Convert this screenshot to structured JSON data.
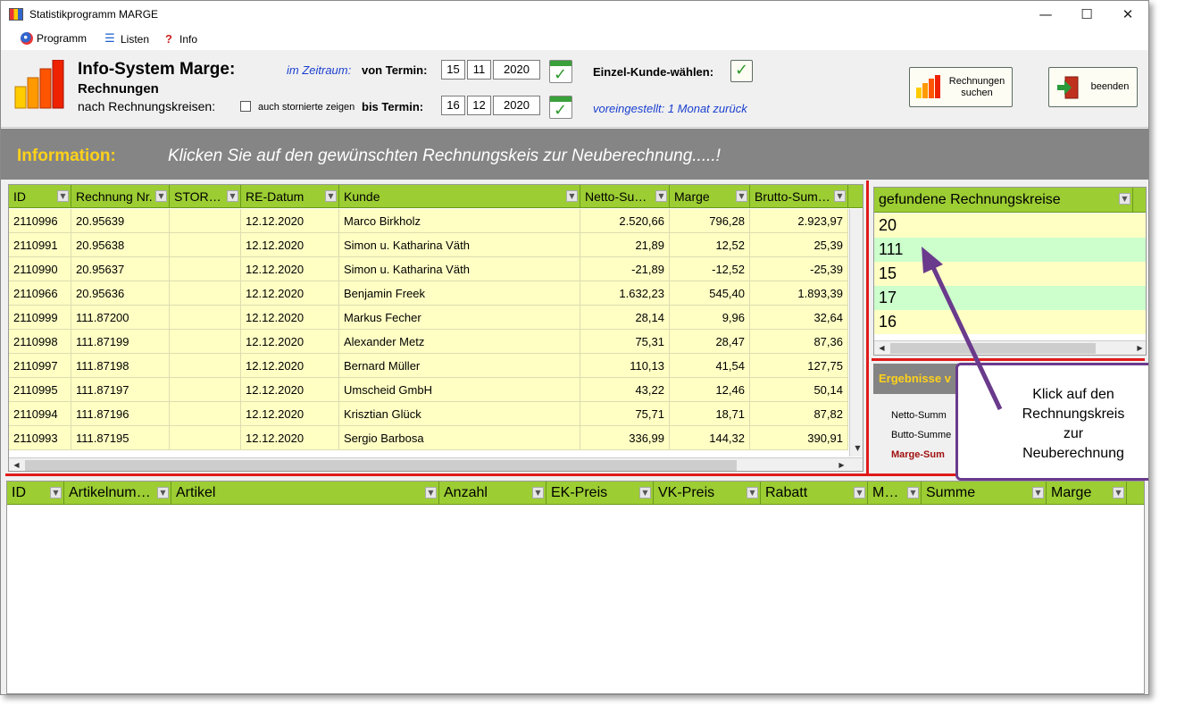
{
  "window": {
    "title": "Statistikprogramm MARGE",
    "controls": {
      "minimize": "—",
      "maximize": "☐",
      "close": "✕"
    }
  },
  "menu": [
    {
      "label": "Programm",
      "icon": "globe-icon"
    },
    {
      "label": "Listen",
      "icon": "list-icon"
    },
    {
      "label": "Info",
      "icon": "question-icon"
    }
  ],
  "header": {
    "title": "Info-System Marge:",
    "subtitle": "Rechnungen",
    "subtitle2": "nach Rechnungskreisen:",
    "period_label": "im Zeitraum:",
    "from_label": "von Termin:",
    "from_day": "15",
    "from_month": "11",
    "from_year": "2020",
    "to_label": "bis Termin:",
    "to_day": "16",
    "to_month": "12",
    "to_year": "2020",
    "storno_label": "auch stornierte zeigen",
    "customer_label": "Einzel-Kunde-wählen:",
    "preset_text": "voreingestellt: 1 Monat zurück",
    "btn_search_line1": "Rechnungen",
    "btn_search_line2": "suchen",
    "btn_exit": "beenden"
  },
  "info": {
    "label": "Information:",
    "message": "Klicken Sie auf den gewünschten Rechnungskeis zur Neuberechnung.....!"
  },
  "invoice_grid": {
    "columns": [
      "ID",
      "Rechnung Nr.",
      "STOR…",
      "RE-Datum",
      "Kunde",
      "Netto-Su…",
      "Marge",
      "Brutto-Sum…"
    ],
    "rows": [
      [
        "2110996",
        "20.95639",
        "",
        "12.12.2020",
        "Marco Birkholz",
        "2.520,66",
        "796,28",
        "2.923,97"
      ],
      [
        "2110991",
        "20.95638",
        "",
        "12.12.2020",
        "Simon u. Katharina Väth",
        "21,89",
        "12,52",
        "25,39"
      ],
      [
        "2110990",
        "20.95637",
        "",
        "12.12.2020",
        "Simon u. Katharina Väth",
        "-21,89",
        "-12,52",
        "-25,39"
      ],
      [
        "2110966",
        "20.95636",
        "",
        "12.12.2020",
        "Benjamin Freek",
        "1.632,23",
        "545,40",
        "1.893,39"
      ],
      [
        "2110999",
        "111.87200",
        "",
        "12.12.2020",
        "Markus Fecher",
        "28,14",
        "9,96",
        "32,64"
      ],
      [
        "2110998",
        "111.87199",
        "",
        "12.12.2020",
        "Alexander Metz",
        "75,31",
        "28,47",
        "87,36"
      ],
      [
        "2110997",
        "111.87198",
        "",
        "12.12.2020",
        "Bernard Müller",
        "110,13",
        "41,54",
        "127,75"
      ],
      [
        "2110995",
        "111.87197",
        "",
        "12.12.2020",
        "Umscheid GmbH",
        "43,22",
        "12,46",
        "50,14"
      ],
      [
        "2110994",
        "111.87196",
        "",
        "12.12.2020",
        "Krisztian Glück",
        "75,71",
        "18,71",
        "87,82"
      ],
      [
        "2110993",
        "111.87195",
        "",
        "12.12.2020",
        "Sergio Barbosa",
        "336,99",
        "144,32",
        "390,91"
      ]
    ]
  },
  "kreise_grid": {
    "header": "gefundene Rechnungskreise",
    "rows": [
      "20",
      "111",
      "15",
      "17",
      "16"
    ]
  },
  "results": {
    "header": "Ergebnisse v",
    "netto": "Netto-Summ",
    "brutto": "Butto-Summe",
    "marge": "Marge-Sum"
  },
  "article_grid": {
    "columns": [
      "ID",
      "Artikelnum…",
      "Artikel",
      "Anzahl",
      "EK-Preis",
      "VK-Preis",
      "Rabatt",
      "M…",
      "Summe",
      "Marge"
    ]
  },
  "callout": {
    "line1": "Klick auf den",
    "line2": "Rechnungskreis",
    "line3": "zur",
    "line4": "Neuberechnung"
  },
  "colors": {
    "grid_header": "#9ccd33",
    "row_yellow": "#ffffc4",
    "row_green": "#ccffcc",
    "info_bar": "#858585",
    "accent_yellow": "#ffd21a",
    "callout_border": "#6a3a8c"
  }
}
